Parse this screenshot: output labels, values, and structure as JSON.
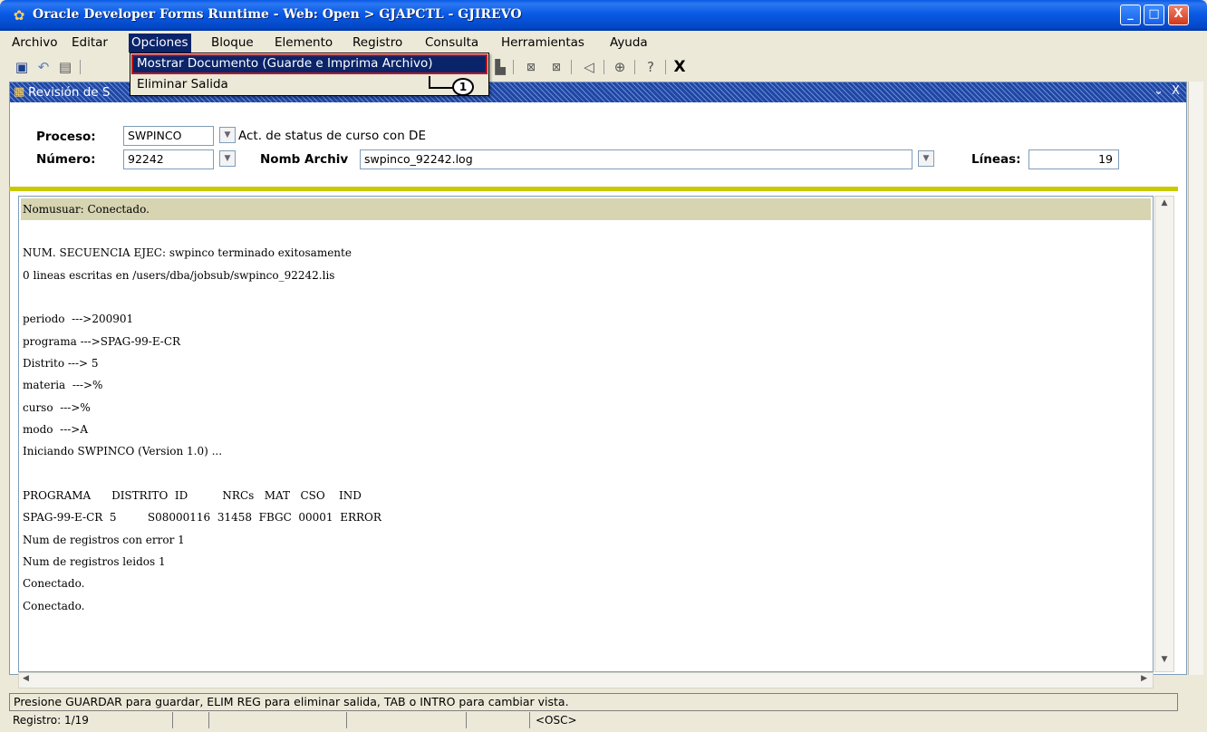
{
  "window": {
    "title": "Oracle Developer Forms Runtime - Web:  Open > GJAPCTL - GJIREVO",
    "controls": [
      "_",
      "□",
      "X"
    ]
  },
  "menubar": {
    "items": [
      "Archivo",
      "Editar",
      "Opciones",
      "Bloque",
      "Elemento",
      "Registro",
      "Consulta",
      "Herramientas",
      "Ayuda"
    ],
    "active": "Opciones"
  },
  "opciones_menu": {
    "items": [
      "Mostrar Documento (Guarde e Imprima Archivo)",
      "Eliminar Salida"
    ],
    "highlighted": "Mostrar Documento (Guarde e Imprima Archivo)"
  },
  "annotation": {
    "marker": "1"
  },
  "toolbar": {
    "icons": [
      "save-icon",
      "rollback-icon",
      "document-icon",
      "print-icon",
      "clear-icon",
      "cut-icon",
      "volume-icon",
      "target-icon",
      "help-icon",
      "exit-icon"
    ],
    "exit_label": "X"
  },
  "inner_window": {
    "title": "Revisión de S",
    "controls": [
      "⌄",
      "X"
    ]
  },
  "form": {
    "proceso_label": "Proceso:",
    "proceso_value": "SWPINCO",
    "proceso_desc": "Act. de status de curso con DE",
    "numero_label": "Número:",
    "numero_value": "92242",
    "nomb_archiv_label": "Nomb Archiv",
    "nomb_archiv_value": "swpinco_92242.log",
    "lineas_label": "Líneas:",
    "lineas_value": "19"
  },
  "log_lines": [
    "Nomusuar: Conectado.",
    "",
    "NUM. SECUENCIA EJEC: swpinco terminado exitosamente",
    "0 lineas escritas en /users/dba/jobsub/swpinco_92242.lis",
    "",
    "periodo  --->200901",
    "programa --->SPAG-99-E-CR",
    "Distrito ---> 5",
    "materia  --->%",
    "curso  --->%",
    "modo  --->A",
    "Iniciando SWPINCO (Version 1.0) ...",
    "",
    "PROGRAMA      DISTRITO  ID          NRCs   MAT   CSO    IND",
    "SPAG-99-E-CR  5         S08000116  31458  FBGC  00001  ERROR",
    "Num de registros con error 1",
    "Num de registros leidos 1",
    "Conectado.",
    "Conectado."
  ],
  "status": {
    "message": "Presione GUARDAR para guardar, ELIM REG para eliminar salida, TAB o INTRO para cambiar vista.",
    "registro": "Registro: 1/19",
    "osc": "<OSC>"
  },
  "colors": {
    "titlebar": "#0a5ae6",
    "menu_highlight": "#0a246a",
    "highlight_border": "#c0141e",
    "divider": "#c9c900",
    "first_line": "#d7d4b2"
  }
}
